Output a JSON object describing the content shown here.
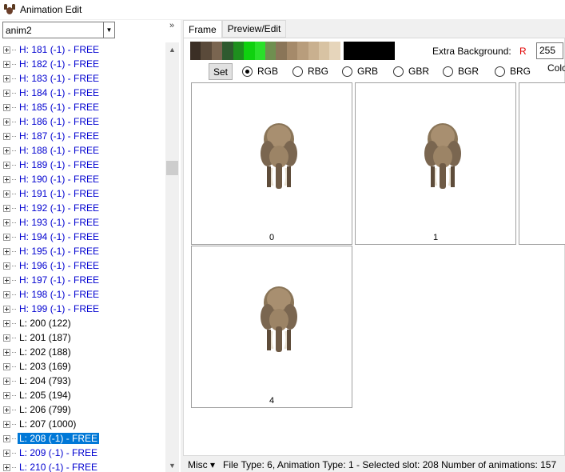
{
  "window": {
    "title": "Animation Edit"
  },
  "left": {
    "combo_value": "anim2",
    "collapse_glyph": "»",
    "tree": [
      {
        "label": "H: 181 (-1) - FREE",
        "kind": "free"
      },
      {
        "label": "H: 182 (-1) - FREE",
        "kind": "free"
      },
      {
        "label": "H: 183 (-1) - FREE",
        "kind": "free"
      },
      {
        "label": "H: 184 (-1) - FREE",
        "kind": "free"
      },
      {
        "label": "H: 185 (-1) - FREE",
        "kind": "free"
      },
      {
        "label": "H: 186 (-1) - FREE",
        "kind": "free"
      },
      {
        "label": "H: 187 (-1) - FREE",
        "kind": "free"
      },
      {
        "label": "H: 188 (-1) - FREE",
        "kind": "free"
      },
      {
        "label": "H: 189 (-1) - FREE",
        "kind": "free"
      },
      {
        "label": "H: 190 (-1) - FREE",
        "kind": "free"
      },
      {
        "label": "H: 191 (-1) - FREE",
        "kind": "free"
      },
      {
        "label": "H: 192 (-1) - FREE",
        "kind": "free"
      },
      {
        "label": "H: 193 (-1) - FREE",
        "kind": "free"
      },
      {
        "label": "H: 194 (-1) - FREE",
        "kind": "free"
      },
      {
        "label": "H: 195 (-1) - FREE",
        "kind": "free"
      },
      {
        "label": "H: 196 (-1) - FREE",
        "kind": "free"
      },
      {
        "label": "H: 197 (-1) - FREE",
        "kind": "free"
      },
      {
        "label": "H: 198 (-1) - FREE",
        "kind": "free"
      },
      {
        "label": "H: 199 (-1) - FREE",
        "kind": "free"
      },
      {
        "label": "L: 200 (122)",
        "kind": "used"
      },
      {
        "label": "L: 201 (187)",
        "kind": "used"
      },
      {
        "label": "L: 202 (188)",
        "kind": "used"
      },
      {
        "label": "L: 203 (169)",
        "kind": "used"
      },
      {
        "label": "L: 204 (793)",
        "kind": "used"
      },
      {
        "label": "L: 205 (194)",
        "kind": "used"
      },
      {
        "label": "L: 206 (799)",
        "kind": "used"
      },
      {
        "label": "L: 207 (1000)",
        "kind": "used"
      },
      {
        "label": "L: 208 (-1) - FREE",
        "kind": "selected"
      },
      {
        "label": "L: 209 (-1) - FREE",
        "kind": "free"
      },
      {
        "label": "L: 210 (-1) - FREE",
        "kind": "free"
      }
    ]
  },
  "tabs": [
    {
      "label": "Frame",
      "active": true
    },
    {
      "label": "Preview/Edit",
      "active": false
    }
  ],
  "palette_colors": [
    "#3b2f25",
    "#5a4a3a",
    "#7a6550",
    "#2f5a2f",
    "#1e8f1e",
    "#0fd10f",
    "#2ae02a",
    "#6f8f50",
    "#8a7558",
    "#a58a6a",
    "#b89d7c",
    "#c9b08f",
    "#d8c3a3",
    "#e6d5bb"
  ],
  "extra_background": {
    "label": "Extra Background:",
    "channel": "R",
    "value": "255",
    "trailing": "Colo"
  },
  "set_button": "Set",
  "color_orders": [
    {
      "label": "RGB",
      "checked": true
    },
    {
      "label": "RBG",
      "checked": false
    },
    {
      "label": "GRB",
      "checked": false
    },
    {
      "label": "GBR",
      "checked": false
    },
    {
      "label": "BGR",
      "checked": false
    },
    {
      "label": "BRG",
      "checked": false
    }
  ],
  "frames": [
    {
      "number": "0"
    },
    {
      "number": "1"
    },
    {
      "number": ""
    },
    {
      "number": "4"
    }
  ],
  "status": {
    "misc": "Misc",
    "text": "File Type: 6, Animation Type: 1 - Selected slot: 208  Number of animations: 157"
  }
}
